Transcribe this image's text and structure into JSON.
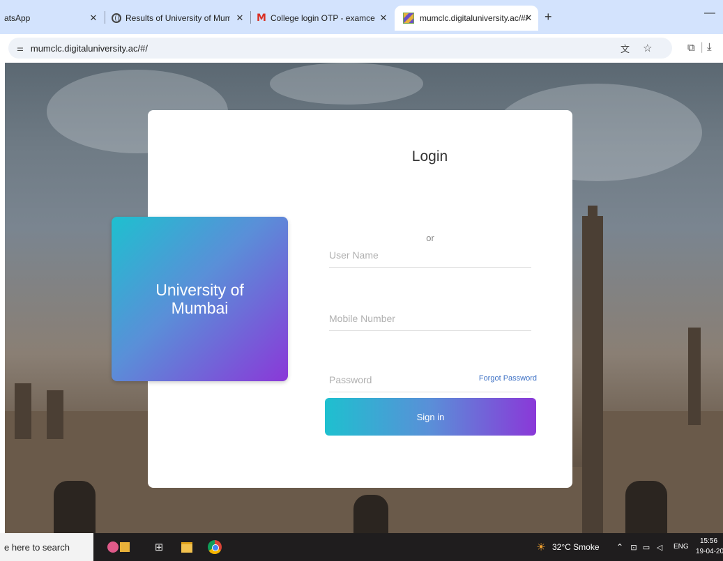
{
  "browser": {
    "tabs": [
      {
        "title": "atsApp",
        "active": false
      },
      {
        "title": "Results of University of Mumb",
        "active": false
      },
      {
        "title": "College login OTP - examcell@",
        "active": false
      },
      {
        "title": "mumclc.digitaluniversity.ac/#/",
        "active": true
      }
    ],
    "url": "mumclc.digitaluniversity.ac/#/"
  },
  "page": {
    "brand_text": "University of Mumbai",
    "login_title": "Login",
    "username_placeholder": "User Name",
    "or_text": "or",
    "mobile_placeholder": "Mobile Number",
    "password_placeholder": "Password",
    "forgot_password": "Forgot Password",
    "signin_label": "Sign in"
  },
  "taskbar": {
    "search_text": "e here to search",
    "weather": "32°C  Smoke",
    "language": "ENG",
    "time": "15:56",
    "date": "19-04-20"
  },
  "colors": {
    "gradient_start": "#1ec0cf",
    "gradient_end": "#8a38d8",
    "link": "#3b6fc4"
  }
}
